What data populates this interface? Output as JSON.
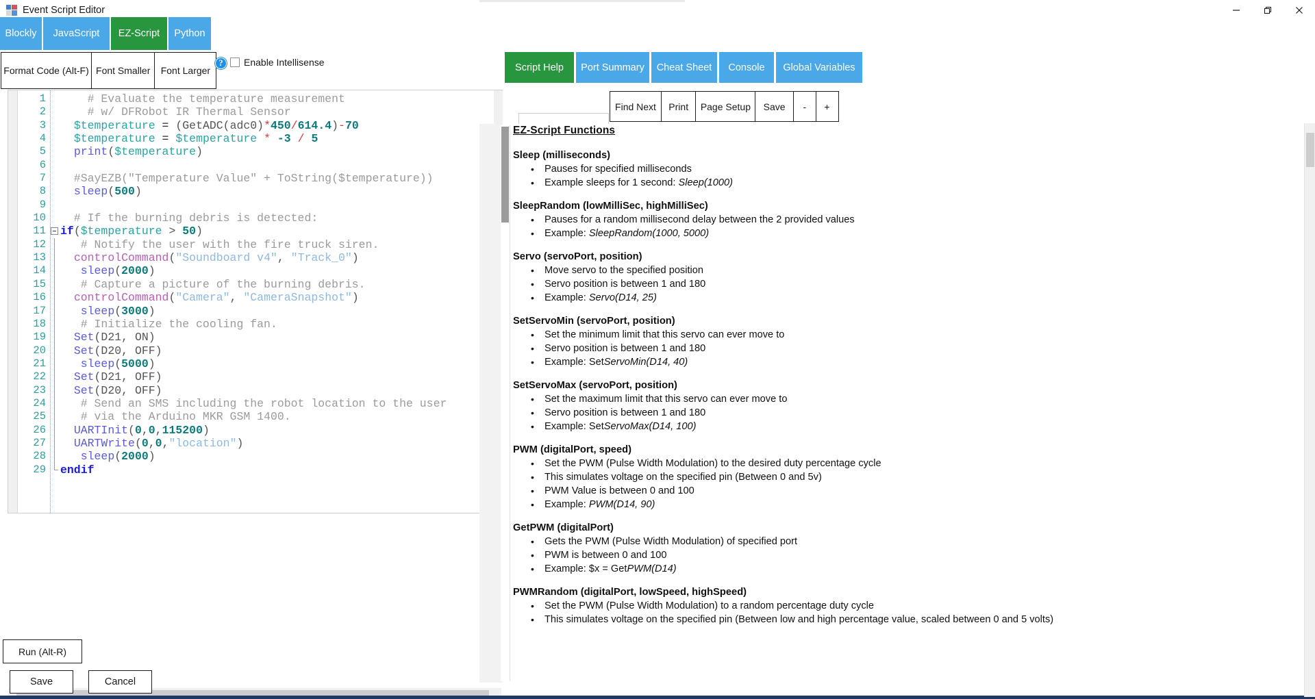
{
  "window": {
    "title": "Event Script Editor",
    "icon": "app-window-icon",
    "controls": [
      {
        "name": "minimize-button",
        "glyph": "minimize"
      },
      {
        "name": "restore-button",
        "glyph": "restore"
      },
      {
        "name": "close-button",
        "glyph": "close"
      }
    ]
  },
  "language_tabs": [
    {
      "label": "Blockly",
      "active": false
    },
    {
      "label": "JavaScript",
      "active": false
    },
    {
      "label": "EZ-Script",
      "active": true
    },
    {
      "label": "Python",
      "active": false
    }
  ],
  "format_toolbar": {
    "buttons": [
      {
        "label": "Format Code (Alt-F)"
      },
      {
        "label": "Font Smaller"
      },
      {
        "label": "Font Larger"
      }
    ],
    "help_icon": "?",
    "intellisense_label": "Enable Intellisense",
    "intellisense_checked": false
  },
  "editor": {
    "first_line_number": 1,
    "last_line_number": 29,
    "lines": [
      {
        "n": "1",
        "fold": "none",
        "tokens": [
          {
            "t": "    # Evaluate the temperature measurement",
            "c": "tk-com"
          }
        ]
      },
      {
        "n": "2",
        "fold": "none",
        "tokens": [
          {
            "t": "    # w/ DFRobot IR Thermal Sensor",
            "c": "tk-com"
          }
        ]
      },
      {
        "n": "3",
        "fold": "none",
        "tokens": [
          {
            "t": "  ",
            "c": "tk-pl"
          },
          {
            "t": "$temperature",
            "c": "tk-var"
          },
          {
            "t": " = ",
            "c": "tk-pl"
          },
          {
            "t": "(GetADC(adc0)",
            "c": "tk-id"
          },
          {
            "t": "*",
            "c": "tk-op"
          },
          {
            "t": "450",
            "c": "tk-num"
          },
          {
            "t": "/",
            "c": "tk-op"
          },
          {
            "t": "614.4",
            "c": "tk-num"
          },
          {
            "t": ")",
            "c": "tk-id"
          },
          {
            "t": "-",
            "c": "tk-op"
          },
          {
            "t": "70",
            "c": "tk-num"
          }
        ]
      },
      {
        "n": "4",
        "fold": "none",
        "tokens": [
          {
            "t": "  ",
            "c": "tk-pl"
          },
          {
            "t": "$temperature",
            "c": "tk-var"
          },
          {
            "t": " = ",
            "c": "tk-pl"
          },
          {
            "t": "$temperature",
            "c": "tk-var"
          },
          {
            "t": " ",
            "c": "tk-pl"
          },
          {
            "t": "*",
            "c": "tk-op"
          },
          {
            "t": " ",
            "c": "tk-pl"
          },
          {
            "t": "-3",
            "c": "tk-num"
          },
          {
            "t": " ",
            "c": "tk-pl"
          },
          {
            "t": "/",
            "c": "tk-op"
          },
          {
            "t": " ",
            "c": "tk-pl"
          },
          {
            "t": "5",
            "c": "tk-num"
          }
        ]
      },
      {
        "n": "5",
        "fold": "none",
        "tokens": [
          {
            "t": "  ",
            "c": "tk-pl"
          },
          {
            "t": "print",
            "c": "tk-fn"
          },
          {
            "t": "(",
            "c": "tk-id"
          },
          {
            "t": "$temperature",
            "c": "tk-var"
          },
          {
            "t": ")",
            "c": "tk-id"
          }
        ]
      },
      {
        "n": "6",
        "fold": "none",
        "tokens": [
          {
            "t": "",
            "c": "tk-pl"
          }
        ]
      },
      {
        "n": "7",
        "fold": "none",
        "tokens": [
          {
            "t": "  #SayEZB(\"Temperature Value\" + ToString($temperature))",
            "c": "tk-com"
          }
        ]
      },
      {
        "n": "8",
        "fold": "none",
        "tokens": [
          {
            "t": "  ",
            "c": "tk-pl"
          },
          {
            "t": "sleep",
            "c": "tk-fn"
          },
          {
            "t": "(",
            "c": "tk-id"
          },
          {
            "t": "500",
            "c": "tk-num"
          },
          {
            "t": ")",
            "c": "tk-id"
          }
        ]
      },
      {
        "n": "9",
        "fold": "none",
        "tokens": [
          {
            "t": "",
            "c": "tk-pl"
          }
        ]
      },
      {
        "n": "10",
        "fold": "none",
        "tokens": [
          {
            "t": "  # If the burning debris is detected:",
            "c": "tk-com"
          }
        ]
      },
      {
        "n": "11",
        "fold": "start",
        "tokens": [
          {
            "t": "if",
            "c": "tk-kw"
          },
          {
            "t": "(",
            "c": "tk-id"
          },
          {
            "t": "$temperature",
            "c": "tk-var"
          },
          {
            "t": " > ",
            "c": "tk-id"
          },
          {
            "t": "50",
            "c": "tk-num"
          },
          {
            "t": ")",
            "c": "tk-id"
          }
        ]
      },
      {
        "n": "12",
        "fold": "bar",
        "tokens": [
          {
            "t": "   # Notify the user with the fire truck siren.",
            "c": "tk-com"
          }
        ]
      },
      {
        "n": "13",
        "fold": "bar",
        "tokens": [
          {
            "t": "  ",
            "c": "tk-pl"
          },
          {
            "t": "controlCommand",
            "c": "tk-cc"
          },
          {
            "t": "(",
            "c": "tk-id"
          },
          {
            "t": "\"Soundboard v4\"",
            "c": "tk-str"
          },
          {
            "t": ", ",
            "c": "tk-id"
          },
          {
            "t": "\"Track_0\"",
            "c": "tk-str"
          },
          {
            "t": ")",
            "c": "tk-id"
          }
        ]
      },
      {
        "n": "14",
        "fold": "bar",
        "tokens": [
          {
            "t": "   ",
            "c": "tk-pl"
          },
          {
            "t": "sleep",
            "c": "tk-fn"
          },
          {
            "t": "(",
            "c": "tk-id"
          },
          {
            "t": "2000",
            "c": "tk-num"
          },
          {
            "t": ")",
            "c": "tk-id"
          }
        ]
      },
      {
        "n": "15",
        "fold": "bar",
        "tokens": [
          {
            "t": "   # Capture a picture of the burning debris.",
            "c": "tk-com"
          }
        ]
      },
      {
        "n": "16",
        "fold": "bar",
        "tokens": [
          {
            "t": "  ",
            "c": "tk-pl"
          },
          {
            "t": "controlCommand",
            "c": "tk-cc"
          },
          {
            "t": "(",
            "c": "tk-id"
          },
          {
            "t": "\"Camera\"",
            "c": "tk-str"
          },
          {
            "t": ", ",
            "c": "tk-id"
          },
          {
            "t": "\"CameraSnapshot\"",
            "c": "tk-str"
          },
          {
            "t": ")",
            "c": "tk-id"
          }
        ]
      },
      {
        "n": "17",
        "fold": "bar",
        "tokens": [
          {
            "t": "   ",
            "c": "tk-pl"
          },
          {
            "t": "sleep",
            "c": "tk-fn"
          },
          {
            "t": "(",
            "c": "tk-id"
          },
          {
            "t": "3000",
            "c": "tk-num"
          },
          {
            "t": ")",
            "c": "tk-id"
          }
        ]
      },
      {
        "n": "18",
        "fold": "bar",
        "tokens": [
          {
            "t": "   # Initialize the cooling fan.",
            "c": "tk-com"
          }
        ]
      },
      {
        "n": "19",
        "fold": "bar",
        "tokens": [
          {
            "t": "  ",
            "c": "tk-pl"
          },
          {
            "t": "Set",
            "c": "tk-fn"
          },
          {
            "t": "(D21, ON)",
            "c": "tk-id"
          }
        ]
      },
      {
        "n": "20",
        "fold": "bar",
        "tokens": [
          {
            "t": "  ",
            "c": "tk-pl"
          },
          {
            "t": "Set",
            "c": "tk-fn"
          },
          {
            "t": "(D20, OFF)",
            "c": "tk-id"
          }
        ]
      },
      {
        "n": "21",
        "fold": "bar",
        "tokens": [
          {
            "t": "   ",
            "c": "tk-pl"
          },
          {
            "t": "sleep",
            "c": "tk-fn"
          },
          {
            "t": "(",
            "c": "tk-id"
          },
          {
            "t": "5000",
            "c": "tk-num"
          },
          {
            "t": ")",
            "c": "tk-id"
          }
        ]
      },
      {
        "n": "22",
        "fold": "bar",
        "tokens": [
          {
            "t": "  ",
            "c": "tk-pl"
          },
          {
            "t": "Set",
            "c": "tk-fn"
          },
          {
            "t": "(D21, OFF)",
            "c": "tk-id"
          }
        ]
      },
      {
        "n": "23",
        "fold": "bar",
        "tokens": [
          {
            "t": "  ",
            "c": "tk-pl"
          },
          {
            "t": "Set",
            "c": "tk-fn"
          },
          {
            "t": "(D20, OFF)",
            "c": "tk-id"
          }
        ]
      },
      {
        "n": "24",
        "fold": "bar",
        "tokens": [
          {
            "t": "   # Send an SMS including the robot location to the user",
            "c": "tk-com"
          }
        ]
      },
      {
        "n": "25",
        "fold": "bar",
        "tokens": [
          {
            "t": "   # via the Arduino MKR GSM 1400.",
            "c": "tk-com"
          }
        ]
      },
      {
        "n": "26",
        "fold": "bar",
        "tokens": [
          {
            "t": "  ",
            "c": "tk-pl"
          },
          {
            "t": "UARTInit",
            "c": "tk-fn"
          },
          {
            "t": "(",
            "c": "tk-id"
          },
          {
            "t": "0",
            "c": "tk-num"
          },
          {
            "t": ",",
            "c": "tk-id"
          },
          {
            "t": "0",
            "c": "tk-num"
          },
          {
            "t": ",",
            "c": "tk-id"
          },
          {
            "t": "115200",
            "c": "tk-num"
          },
          {
            "t": ")",
            "c": "tk-id"
          }
        ]
      },
      {
        "n": "27",
        "fold": "bar",
        "tokens": [
          {
            "t": "  ",
            "c": "tk-pl"
          },
          {
            "t": "UARTWrite",
            "c": "tk-fn"
          },
          {
            "t": "(",
            "c": "tk-id"
          },
          {
            "t": "0",
            "c": "tk-num"
          },
          {
            "t": ",",
            "c": "tk-id"
          },
          {
            "t": "0",
            "c": "tk-num"
          },
          {
            "t": ",",
            "c": "tk-id"
          },
          {
            "t": "\"location\"",
            "c": "tk-str"
          },
          {
            "t": ")",
            "c": "tk-id"
          }
        ]
      },
      {
        "n": "28",
        "fold": "bar",
        "tokens": [
          {
            "t": "   ",
            "c": "tk-pl"
          },
          {
            "t": "sleep",
            "c": "tk-fn"
          },
          {
            "t": "(",
            "c": "tk-id"
          },
          {
            "t": "2000",
            "c": "tk-num"
          },
          {
            "t": ")",
            "c": "tk-id"
          }
        ]
      },
      {
        "n": "29",
        "fold": "end",
        "tokens": [
          {
            "t": "endif",
            "c": "tk-kw"
          }
        ]
      }
    ]
  },
  "actions": {
    "run_label": "Run (Alt-R)",
    "save_label": "Save",
    "cancel_label": "Cancel"
  },
  "help_tabs": [
    {
      "label": "Script Help",
      "active": true
    },
    {
      "label": "Port Summary",
      "active": false
    },
    {
      "label": "Cheat Sheet",
      "active": false
    },
    {
      "label": "Console",
      "active": false
    },
    {
      "label": "Global Variables",
      "active": false
    }
  ],
  "find_bar": {
    "search_value": "",
    "search_placeholder": "",
    "buttons": [
      {
        "label": "Find Next"
      },
      {
        "label": "Print"
      },
      {
        "label": "Page Setup"
      },
      {
        "label": "Save"
      },
      {
        "label": "-"
      },
      {
        "label": "+"
      }
    ]
  },
  "docs": {
    "title": "EZ-Script Functions",
    "functions": [
      {
        "name": "Sleep (milliseconds)",
        "bullets": [
          {
            "text": "Pauses for specified milliseconds",
            "em": ""
          },
          {
            "text": "Example sleeps for 1 second: ",
            "em": "Sleep(1000)"
          }
        ]
      },
      {
        "name": "SleepRandom (lowMilliSec, highMilliSec)",
        "bullets": [
          {
            "text": "Pauses for a random millisecond delay between the 2 provided values",
            "em": ""
          },
          {
            "text": "Example: ",
            "em": "SleepRandom(1000, 5000)"
          }
        ]
      },
      {
        "name": "Servo (servoPort, position)",
        "bullets": [
          {
            "text": "Move servo to the specified position",
            "em": ""
          },
          {
            "text": "Servo position is between 1 and 180",
            "em": ""
          },
          {
            "text": "Example: ",
            "em": "Servo(D14, 25)"
          }
        ]
      },
      {
        "name": "SetServoMin (servoPort, position)",
        "bullets": [
          {
            "text": "Set the minimum limit that this servo can ever move to",
            "em": ""
          },
          {
            "text": "Servo position is between 1 and 180",
            "em": ""
          },
          {
            "text": "Example: Set",
            "em": "ServoMin(D14, 40)"
          }
        ]
      },
      {
        "name": "SetServoMax (servoPort, position)",
        "bullets": [
          {
            "text": "Set the maximum limit that this servo can ever move to",
            "em": ""
          },
          {
            "text": "Servo position is between 1 and 180",
            "em": ""
          },
          {
            "text": "Example: Set",
            "em": "ServoMax(D14, 100)"
          }
        ]
      },
      {
        "name": "PWM (digitalPort, speed)",
        "bullets": [
          {
            "text": "Set the PWM (Pulse Width Modulation) to the desired duty percentage cycle",
            "em": ""
          },
          {
            "text": "This simulates voltage on the specified pin (Between 0 and 5v)",
            "em": ""
          },
          {
            "text": "PWM Value is between 0 and 100",
            "em": ""
          },
          {
            "text": "Example: ",
            "em": "PWM(D14, 90)"
          }
        ]
      },
      {
        "name": "GetPWM (digitalPort)",
        "bullets": [
          {
            "text": "Gets the PWM (Pulse Width Modulation) of specified port",
            "em": ""
          },
          {
            "text": "PWM is between 0 and 100",
            "em": ""
          },
          {
            "text": "Example: $x = Get",
            "em": "PWM(D14)"
          }
        ]
      },
      {
        "name": "PWMRandom (digitalPort, lowSpeed, highSpeed)",
        "bullets": [
          {
            "text": "Set the PWM (Pulse Width Modulation) to a random percentage duty cycle",
            "em": ""
          },
          {
            "text": "This simulates voltage on the specified pin (Between low and high percentage value, scaled between 0 and 5 volts)",
            "em": ""
          }
        ]
      }
    ]
  }
}
